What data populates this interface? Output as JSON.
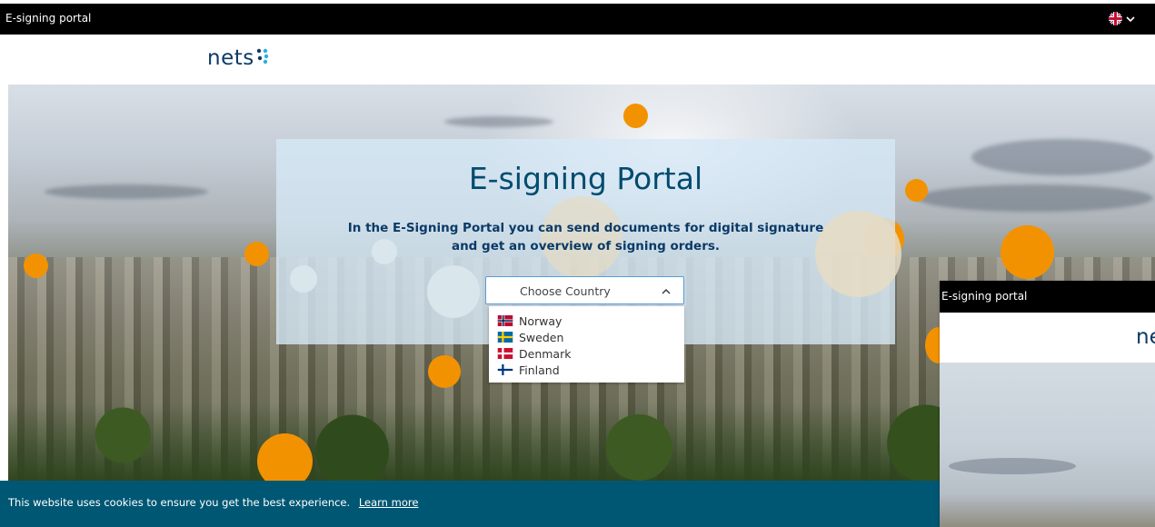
{
  "header": {
    "title": "E-signing portal",
    "language_icon": "uk-flag-icon"
  },
  "logo": {
    "text": "nets"
  },
  "hero": {
    "title": "E-signing Portal",
    "description_line1": "In the E-Signing Portal you can send documents for digital signature",
    "description_line2": "and get an overview of signing orders."
  },
  "country_select": {
    "placeholder": "Choose Country",
    "expanded": true,
    "options": [
      {
        "label": "Norway",
        "flag": "norway-flag-icon"
      },
      {
        "label": "Sweden",
        "flag": "sweden-flag-icon"
      },
      {
        "label": "Denmark",
        "flag": "denmark-flag-icon"
      },
      {
        "label": "Finland",
        "flag": "finland-flag-icon"
      }
    ]
  },
  "cookie_banner": {
    "message": "This website uses cookies to ensure you get the best experience.",
    "link": "Learn more"
  },
  "overlay_window": {
    "title": "E-signing portal",
    "logo_fragment": "ne"
  },
  "colors": {
    "brand_blue": "#0b3a67",
    "accent_orange": "#f39200",
    "cookie_bg": "#005774",
    "title_teal": "#004b6f"
  }
}
